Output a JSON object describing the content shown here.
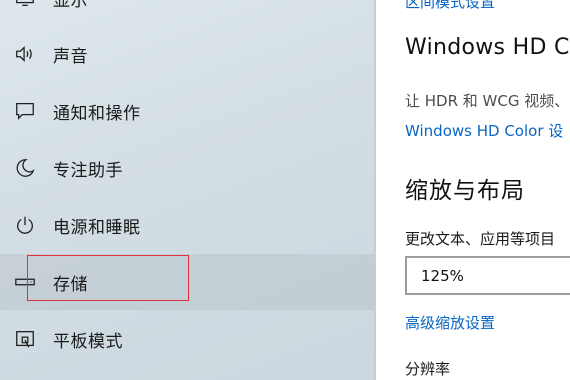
{
  "sidebar": {
    "items": [
      {
        "label": "显示",
        "icon": "display-icon",
        "selected": false
      },
      {
        "label": "声音",
        "icon": "speaker-icon",
        "selected": false
      },
      {
        "label": "通知和操作",
        "icon": "notification-icon",
        "selected": false
      },
      {
        "label": "专注助手",
        "icon": "moon-icon",
        "selected": false
      },
      {
        "label": "电源和睡眠",
        "icon": "power-icon",
        "selected": false
      },
      {
        "label": "存储",
        "icon": "storage-icon",
        "selected": true
      },
      {
        "label": "平板模式",
        "icon": "tablet-mode-icon",
        "selected": false
      }
    ],
    "highlight_color": "#e0323a"
  },
  "content": {
    "top_link": "区间模式设置",
    "hd_color_heading": "Windows HD Co",
    "hd_color_desc": "让 HDR 和 WCG 视频、",
    "hd_color_link": "Windows HD Color 设",
    "scale_heading": "缩放与布局",
    "scale_label": "更改文本、应用等项目",
    "scale_value": "125%",
    "advanced_scaling_link": "高级缩放设置",
    "resolution_label": "分辨率"
  },
  "colors": {
    "link": "#0a66c2",
    "sidebar_bg": "#d3dee4"
  }
}
